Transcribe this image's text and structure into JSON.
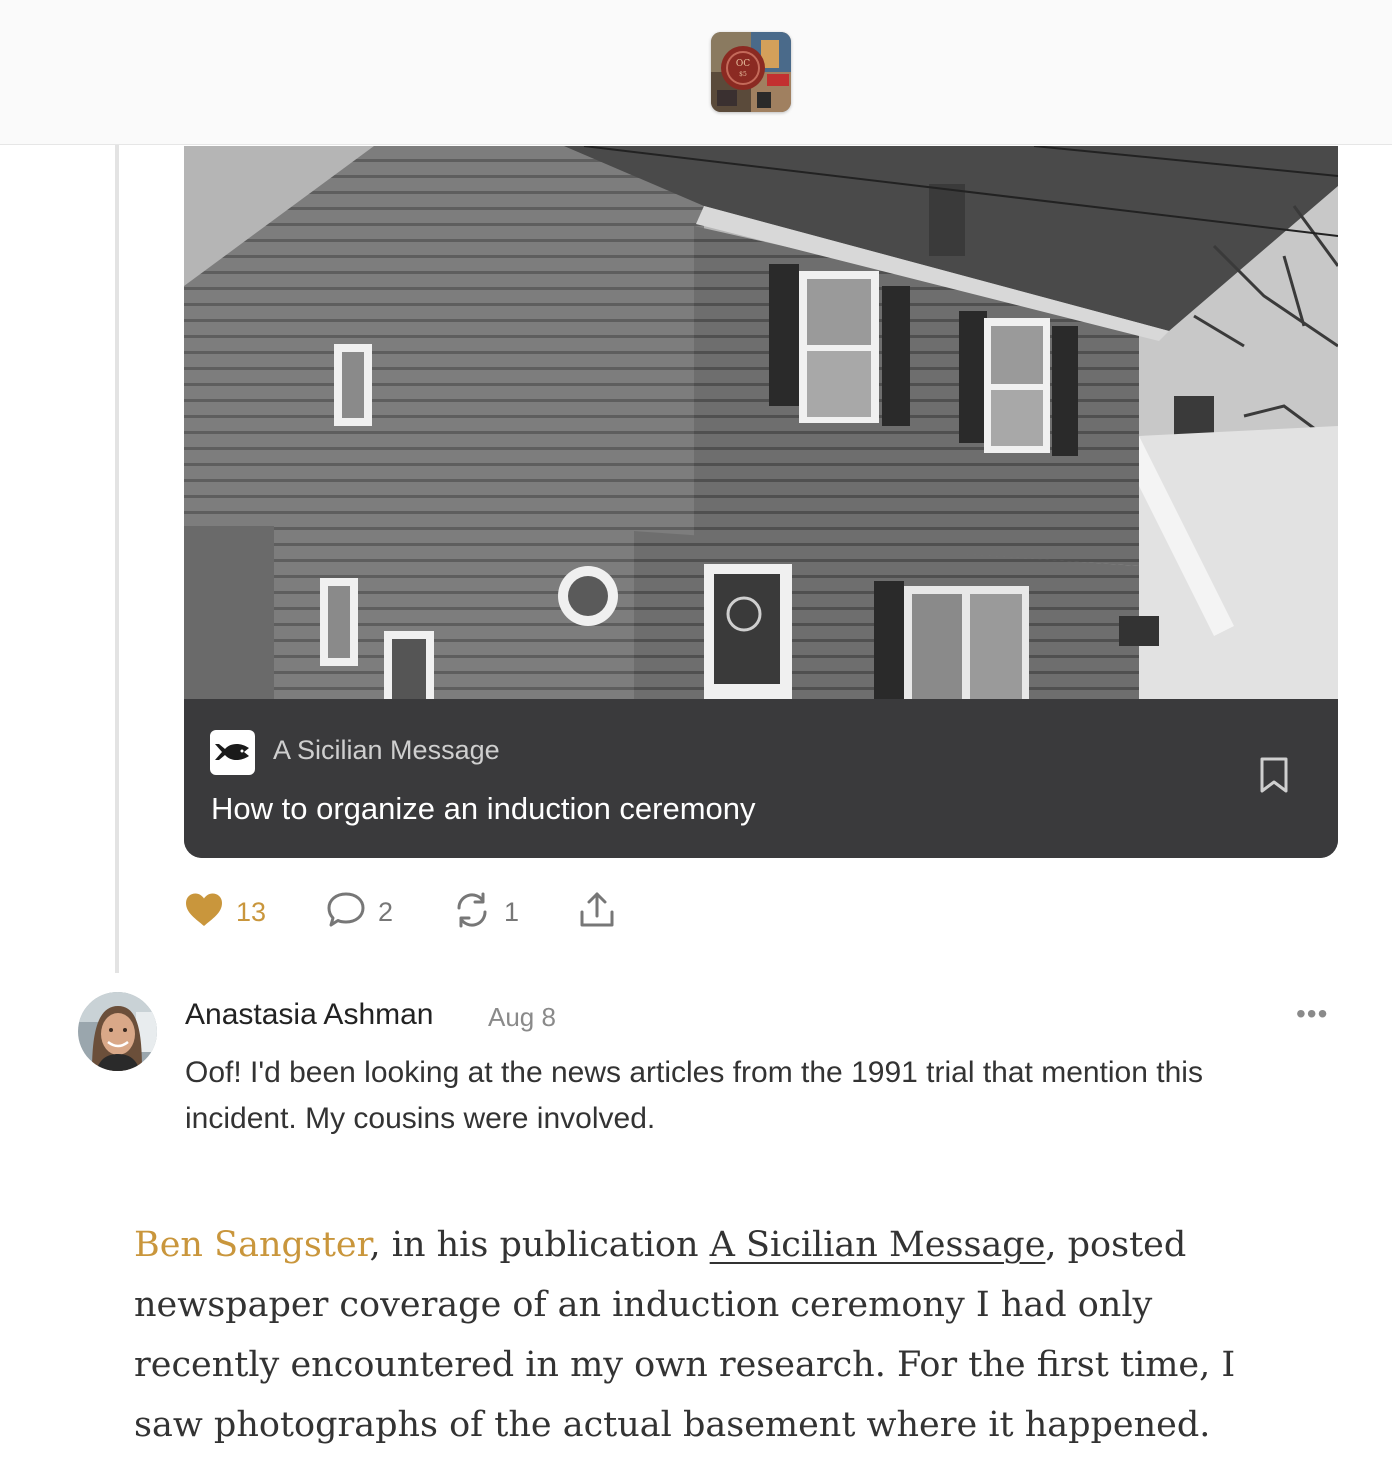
{
  "header": {
    "logo_icon": "publication-logo-icon"
  },
  "embed": {
    "publication_name": "A Sicilian Message",
    "post_title": "How to organize an induction ceremony",
    "publication_icon": "fish-icon",
    "bookmark_icon": "bookmark-icon"
  },
  "actions": {
    "likes": "13",
    "comments": "2",
    "restacks": "1",
    "like_icon": "heart-icon",
    "comment_icon": "comment-icon",
    "restack_icon": "restack-icon",
    "share_icon": "share-icon"
  },
  "comment": {
    "author": "Anastasia Ashman",
    "date": "Aug 8",
    "more": "•••",
    "body": "Oof! I'd been looking at the news articles from the 1991 trial that mention this incident. My cousins were involved."
  },
  "article": {
    "author_link": "Ben Sangster",
    "text_1": ", in his publication ",
    "publication_link": "A Sicilian Message",
    "text_2": ", posted newspaper coverage of an induction ceremony I had only recently encountered in my own research. For the first time, I saw photographs of the actual basement where it happened."
  },
  "colors": {
    "accent": "#c9963c",
    "card_footer": "#3a3a3c",
    "thread_line": "#e3e3e3"
  }
}
